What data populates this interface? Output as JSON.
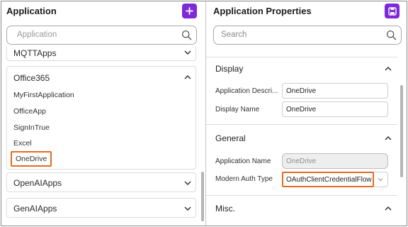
{
  "left_panel": {
    "title": "Application",
    "add_icon": "plus-icon",
    "search": {
      "placeholder": "Application",
      "icon": "search-icon"
    },
    "groups": [
      {
        "label": "MQTTApps",
        "state": "collapsed"
      },
      {
        "label": "Office365",
        "state": "expanded",
        "children": [
          "MyFirstApplication",
          "OfficeApp",
          "SignInTrue",
          "Excel",
          "OneDrive"
        ],
        "selected": "OneDrive"
      },
      {
        "label": "OpenAIApps",
        "state": "collapsed"
      },
      {
        "label": "GenAIApps",
        "state": "collapsed"
      }
    ]
  },
  "right_panel": {
    "title": "Application Properties",
    "save_icon": "save-icon",
    "search": {
      "placeholder": "Search",
      "icon": "search-icon"
    },
    "sections": [
      {
        "title": "Display",
        "state": "expanded",
        "fields": [
          {
            "label": "Application Descri...",
            "value": "OneDrive"
          },
          {
            "label": "Display Name",
            "value": "OneDrive"
          }
        ]
      },
      {
        "title": "General",
        "state": "expanded",
        "fields": [
          {
            "label": "Application Name",
            "value": "OneDrive",
            "disabled": true
          },
          {
            "label": "Modern Auth Type",
            "value": "OAuthClientCredentialFlow",
            "type": "select"
          }
        ]
      },
      {
        "title": "Misc.",
        "state": "expanded",
        "fields": []
      }
    ]
  },
  "colors": {
    "accent": "#7e2ad9",
    "highlight": "#e46b22"
  }
}
